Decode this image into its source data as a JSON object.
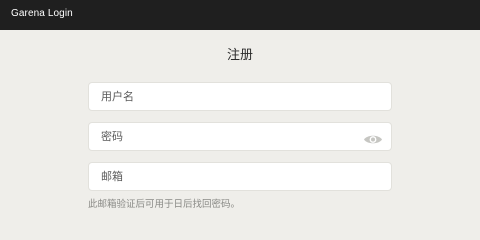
{
  "window": {
    "title": "Garena Login"
  },
  "page": {
    "heading": "注册"
  },
  "form": {
    "username_placeholder": "用户名",
    "password_placeholder": "密码",
    "email_placeholder": "邮箱",
    "email_hint": "此邮箱验证后可用于日后找回密码。",
    "password_toggle_icon": "eye-icon"
  },
  "colors": {
    "title_bar_bg": "#1f1f1f",
    "page_bg": "#efeeea",
    "input_bg": "#ffffff",
    "hint_text": "#8a8a86"
  }
}
